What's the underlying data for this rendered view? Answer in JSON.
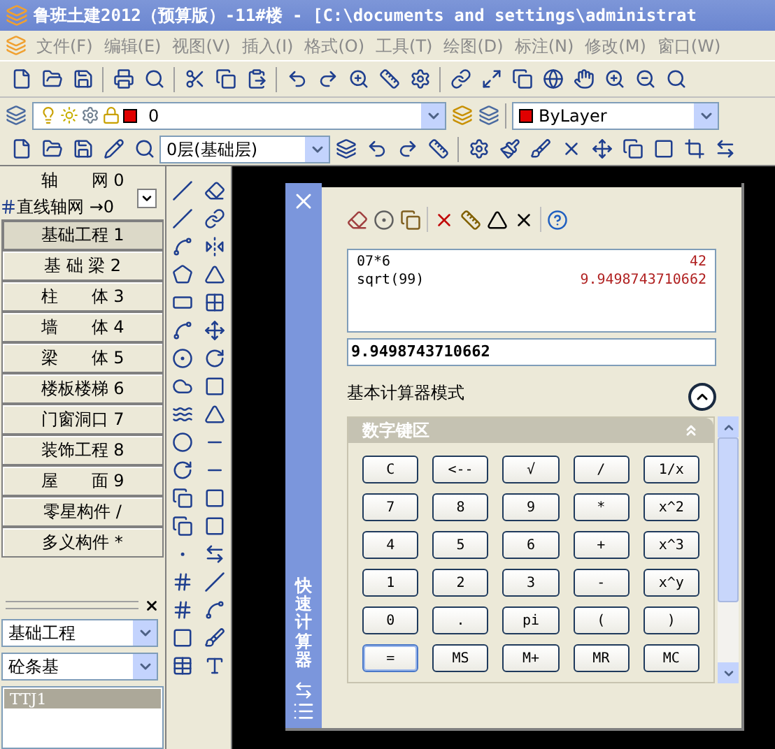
{
  "window": {
    "title": "鲁班土建2012（预算版）-11#楼 - [C:\\documents and settings\\administrat"
  },
  "menu": [
    "文件(F)",
    "编辑(E)",
    "视图(V)",
    "插入(I)",
    "格式(O)",
    "工具(T)",
    "绘图(D)",
    "标注(N)",
    "修改(M)",
    "窗口(W)"
  ],
  "layer_toolbar": {
    "layer": "0",
    "color_setting": "ByLayer"
  },
  "floor_toolbar": {
    "floor": "0层(基础层)"
  },
  "component_panel": {
    "header": "轴　　网 0",
    "sub_item": "直线轴网 →0",
    "items": [
      {
        "label": "基础工程 1",
        "selected": true
      },
      {
        "label": "基 础 梁 2",
        "selected": false
      },
      {
        "label": "柱　　体 3",
        "selected": false
      },
      {
        "label": "墙　　体 4",
        "selected": false
      },
      {
        "label": "梁　　体 5",
        "selected": false
      },
      {
        "label": "楼板楼梯 6",
        "selected": false
      },
      {
        "label": "门窗洞口 7",
        "selected": false
      },
      {
        "label": "装饰工程 8",
        "selected": false
      },
      {
        "label": "屋　　面 9",
        "selected": false
      },
      {
        "label": "零星构件 /",
        "selected": false
      },
      {
        "label": "多义构件 *",
        "selected": false
      }
    ]
  },
  "property_panel": {
    "category": "基础工程",
    "type": "砼条基",
    "list": [
      {
        "label": "TTJ1",
        "selected": true
      }
    ]
  },
  "calculator": {
    "side_title": "快速计算器",
    "history": [
      {
        "expression": "07*6",
        "result": "42"
      },
      {
        "expression": "sqrt(99)",
        "result": "9.9498743710662"
      }
    ],
    "input": "9.9498743710662",
    "mode": "基本计算器模式",
    "keypad_title": "数字键区",
    "keys": [
      [
        {
          "label": "C",
          "focused": false
        },
        {
          "label": "<--",
          "focused": false
        },
        {
          "label": "√",
          "focused": false
        },
        {
          "label": "/",
          "focused": false
        },
        {
          "label": "1/x",
          "focused": false
        }
      ],
      [
        {
          "label": "7",
          "focused": false
        },
        {
          "label": "8",
          "focused": false
        },
        {
          "label": "9",
          "focused": false
        },
        {
          "label": "*",
          "focused": false
        },
        {
          "label": "x^2",
          "focused": false
        }
      ],
      [
        {
          "label": "4",
          "focused": false
        },
        {
          "label": "5",
          "focused": false
        },
        {
          "label": "6",
          "focused": false
        },
        {
          "label": "+",
          "focused": false
        },
        {
          "label": "x^3",
          "focused": false
        }
      ],
      [
        {
          "label": "1",
          "focused": false
        },
        {
          "label": "2",
          "focused": false
        },
        {
          "label": "3",
          "focused": false
        },
        {
          "label": "-",
          "focused": false
        },
        {
          "label": "x^y",
          "focused": false
        }
      ],
      [
        {
          "label": "0",
          "focused": false
        },
        {
          "label": ".",
          "focused": false
        },
        {
          "label": "pi",
          "focused": false
        },
        {
          "label": "(",
          "focused": false
        },
        {
          "label": ")",
          "focused": false
        }
      ],
      [
        {
          "label": "=",
          "focused": true
        },
        {
          "label": "MS",
          "focused": false
        },
        {
          "label": "M+",
          "focused": false
        },
        {
          "label": "MR",
          "focused": false
        },
        {
          "label": "MC",
          "focused": false
        }
      ]
    ]
  }
}
